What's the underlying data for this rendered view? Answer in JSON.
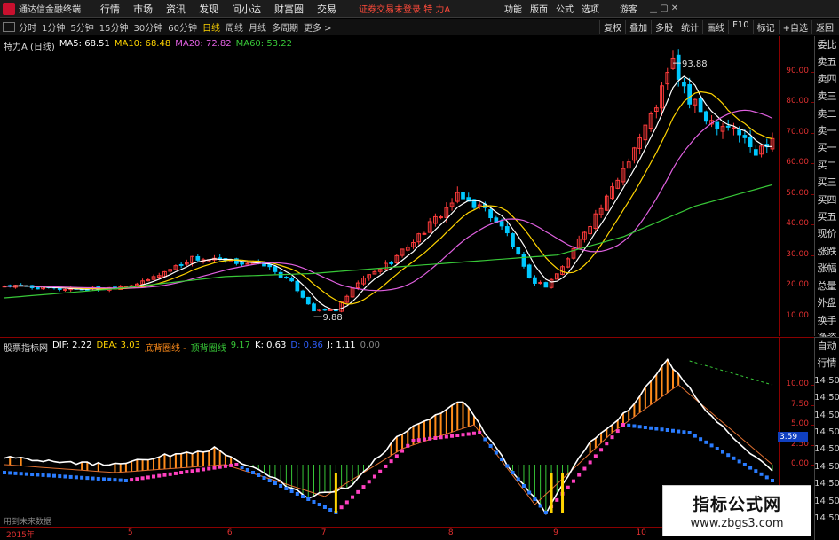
{
  "app": {
    "title": "通达信金融终端",
    "menu": [
      "行情",
      "市场",
      "资讯",
      "发现",
      "问小达",
      "财富圈",
      "交易"
    ],
    "notice": "证券交易未登录",
    "stock_title": "特 力A",
    "right_menu": [
      "功能",
      "版面",
      "公式",
      "选项"
    ],
    "guest": "游客",
    "window_controls": [
      "▁",
      "▢",
      "✕"
    ]
  },
  "timeframes": [
    "分时",
    "1分钟",
    "5分钟",
    "15分钟",
    "30分钟",
    "60分钟",
    "日线",
    "周线",
    "月线",
    "多周期",
    "更多 >"
  ],
  "active_timeframe": "日线",
  "right_tools": [
    "复权",
    "叠加",
    "多股",
    "统计",
    "画线",
    "F10",
    "标记",
    "+自选",
    "返回"
  ],
  "main_legend": {
    "name": "特力A (日线)",
    "ma5": "MA5: 68.51",
    "ma10": "MA10: 68.48",
    "ma20": "MA20: 72.82",
    "ma60": "MA60: 53.22"
  },
  "ind_legend": {
    "name": "股票指标网",
    "dif": "DIF: 2.22",
    "dea": "DEA: 3.03",
    "label1": "底背圈线 -",
    "label2": "顶背圈线",
    "v1": "9.17",
    "k": "K: 0.63",
    "d": "D: 0.86",
    "j": "J: 1.11",
    "j2": "0.00"
  },
  "price_axis": [
    "90.00",
    "80.00",
    "70.00",
    "60.00",
    "50.00",
    "40.00",
    "30.00",
    "20.00",
    "10.00"
  ],
  "ind_axis": [
    "10.00",
    "7.50",
    "5.00",
    "2.50",
    "0.00"
  ],
  "ind_badge": "3.59",
  "annotations": {
    "high": "93.88",
    "low": "9.88"
  },
  "dates": [
    "2015年",
    "5",
    "6",
    "7",
    "8",
    "9",
    "10"
  ],
  "side_top": [
    "委比",
    "卖五",
    "卖四",
    "卖三",
    "卖二",
    "卖一",
    "买一",
    "买二",
    "买三",
    "买四",
    "买五",
    "现价",
    "涨跌",
    "涨幅",
    "总量",
    "外盘",
    "换手",
    "净资",
    "收益"
  ],
  "side_bottom": [
    "自动",
    "行情",
    "14:50",
    "14:50",
    "14:50",
    "14:50",
    "14:50",
    "14:50",
    "14:50",
    "14:50",
    "14:50"
  ],
  "missing_info": "用到未来数据",
  "watermark": {
    "line1": "指标公式网",
    "line2": "www.zbgs3.com"
  },
  "colors": {
    "up": "#ff3b3b",
    "down": "#00c8ff",
    "ma5": "#ffffff",
    "ma10": "#ffd400",
    "ma20": "#e060e0",
    "ma60": "#38c838",
    "axis": "#e03030"
  },
  "chart_data": {
    "type": "candlestick",
    "ylim": [
      5,
      100
    ],
    "close_anchors": [
      [
        0,
        20
      ],
      [
        10,
        19
      ],
      [
        18,
        19
      ],
      [
        25,
        21
      ],
      [
        34,
        29
      ],
      [
        40,
        28
      ],
      [
        47,
        27
      ],
      [
        52,
        21
      ],
      [
        56,
        12
      ],
      [
        60,
        12
      ],
      [
        64,
        21
      ],
      [
        70,
        28
      ],
      [
        76,
        38
      ],
      [
        82,
        49
      ],
      [
        87,
        45
      ],
      [
        91,
        37
      ],
      [
        95,
        22
      ],
      [
        98,
        20
      ],
      [
        101,
        26
      ],
      [
        105,
        38
      ],
      [
        109,
        48
      ],
      [
        113,
        62
      ],
      [
        117,
        75
      ],
      [
        121,
        93
      ],
      [
        124,
        80
      ],
      [
        128,
        74
      ],
      [
        132,
        72
      ],
      [
        136,
        63
      ],
      [
        139,
        69
      ]
    ],
    "ma60_anchors": [
      [
        0,
        16
      ],
      [
        20,
        19
      ],
      [
        40,
        23
      ],
      [
        56,
        24
      ],
      [
        70,
        26
      ],
      [
        85,
        28
      ],
      [
        100,
        30
      ],
      [
        112,
        36
      ],
      [
        125,
        46
      ],
      [
        139,
        53
      ]
    ]
  },
  "indicator_data": {
    "type": "line",
    "ylim": [
      -7,
      15
    ],
    "envelope_anchors": [
      [
        0,
        1
      ],
      [
        18,
        0
      ],
      [
        38,
        2
      ],
      [
        55,
        -4
      ],
      [
        62,
        -3
      ],
      [
        72,
        4
      ],
      [
        83,
        8
      ],
      [
        92,
        -1
      ],
      [
        98,
        -6
      ],
      [
        105,
        2
      ],
      [
        113,
        7
      ],
      [
        120,
        13
      ],
      [
        128,
        6
      ],
      [
        139,
        -1
      ]
    ],
    "dea_anchors": [
      [
        0,
        0
      ],
      [
        20,
        -1
      ],
      [
        40,
        0
      ],
      [
        58,
        -4
      ],
      [
        72,
        2
      ],
      [
        85,
        5
      ],
      [
        96,
        -5
      ],
      [
        110,
        4
      ],
      [
        122,
        10
      ],
      [
        139,
        0
      ]
    ],
    "signal_anchors": [
      [
        0,
        -1
      ],
      [
        22,
        -2
      ],
      [
        42,
        0
      ],
      [
        60,
        -6
      ],
      [
        74,
        3
      ],
      [
        86,
        4
      ],
      [
        98,
        -6
      ],
      [
        112,
        5
      ],
      [
        124,
        4
      ],
      [
        139,
        -2
      ]
    ],
    "trend_line": [
      [
        124,
        13
      ],
      [
        139,
        10
      ]
    ]
  }
}
